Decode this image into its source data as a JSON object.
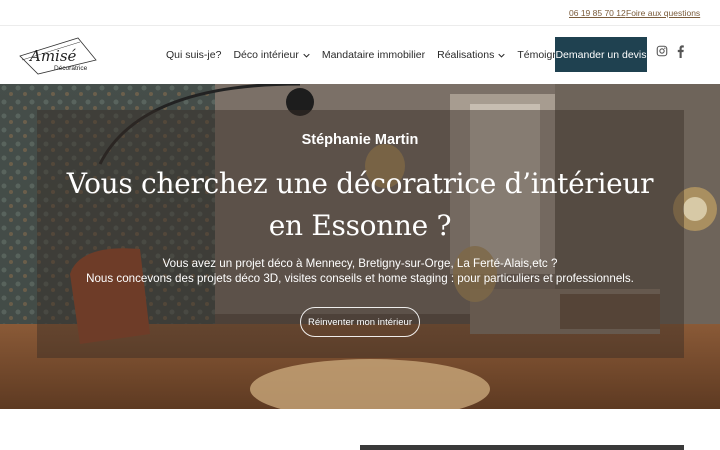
{
  "topbar": {
    "phone": "06 19 85 70 12",
    "faq": "Foire aux questions"
  },
  "brand": {
    "logo_script": "Amisé",
    "logo_tag": "Décoratrice"
  },
  "nav": {
    "items": [
      {
        "label": "Qui suis-je?",
        "dropdown": false
      },
      {
        "label": "Déco intérieur",
        "dropdown": true
      },
      {
        "label": "Mandataire immobilier",
        "dropdown": false
      },
      {
        "label": "Réalisations",
        "dropdown": true
      },
      {
        "label": "Témoignages",
        "dropdown": false
      }
    ],
    "cta": "Demander un devis",
    "social": [
      "instagram-icon",
      "facebook-icon"
    ]
  },
  "hero": {
    "subtitle": "Stéphanie Martin",
    "title": "Vous cherchez une décoratrice d’intérieur en Essonne ?",
    "line1": "Vous avez un projet déco à Mennecy, Bretigny-sur-Orge, La Ferté-Alais,etc ?",
    "line2": "Nous concevons des projets déco 3D, visites conseils et home staging : pour particuliers et professionnels.",
    "button": "Réinventer mon intérieur"
  },
  "colors": {
    "accent": "#1f4150",
    "link": "#7a5b3a"
  }
}
